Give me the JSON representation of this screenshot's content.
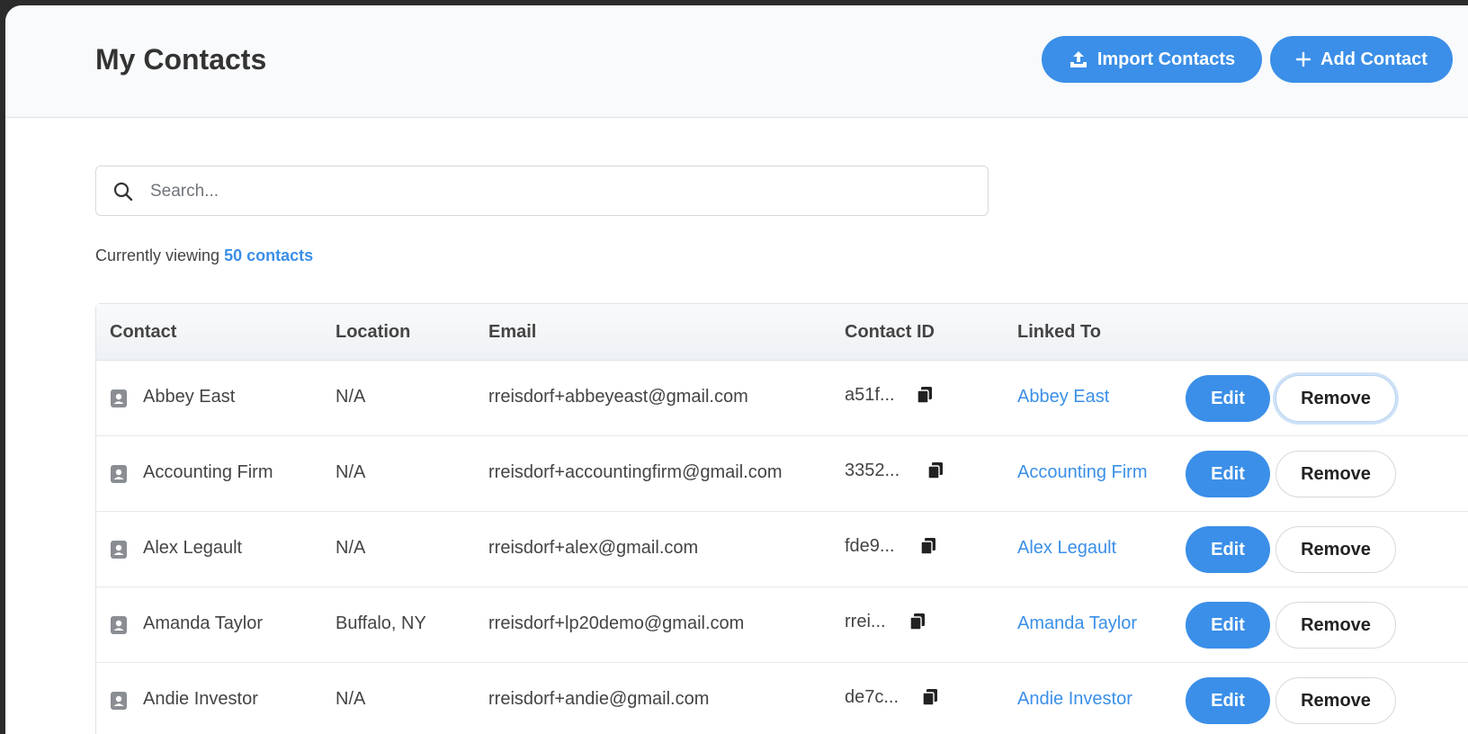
{
  "header": {
    "title": "My Contacts",
    "import_label": "Import Contacts",
    "add_label": "Add Contact"
  },
  "search": {
    "placeholder": "Search...",
    "value": ""
  },
  "summary": {
    "prefix": "Currently viewing ",
    "count": "50 contacts"
  },
  "table": {
    "columns": [
      "Contact",
      "Location",
      "Email",
      "Contact ID",
      "Linked To"
    ],
    "rows": [
      {
        "name": "Abbey East",
        "location": "N/A",
        "email": "rreisdorf+abbeyeast@gmail.com",
        "id": "a51f...",
        "linked": "Abbey East",
        "edit": "Edit",
        "remove": "Remove"
      },
      {
        "name": "Accounting Firm",
        "location": "N/A",
        "email": "rreisdorf+accountingfirm@gmail.com",
        "id": "3352...",
        "linked": "Accounting Firm",
        "edit": "Edit",
        "remove": "Remove"
      },
      {
        "name": "Alex Legault",
        "location": "N/A",
        "email": "rreisdorf+alex@gmail.com",
        "id": "fde9...",
        "linked": "Alex Legault",
        "edit": "Edit",
        "remove": "Remove"
      },
      {
        "name": "Amanda Taylor",
        "location": "Buffalo, NY",
        "email": "rreisdorf+lp20demo@gmail.com",
        "id": "rrei...",
        "linked": "Amanda Taylor",
        "edit": "Edit",
        "remove": "Remove"
      },
      {
        "name": "Andie Investor",
        "location": "N/A",
        "email": "rreisdorf+andie@gmail.com",
        "id": "de7c...",
        "linked": "Andie Investor",
        "edit": "Edit",
        "remove": "Remove"
      }
    ]
  },
  "colors": {
    "accent": "#3b8fe8",
    "header_bg": "#f8fafc",
    "text": "#444444"
  },
  "icons": {
    "import": "upload-icon",
    "add": "plus-icon",
    "search": "search-icon",
    "contact": "contact-card-icon",
    "copy": "copy-icon"
  }
}
